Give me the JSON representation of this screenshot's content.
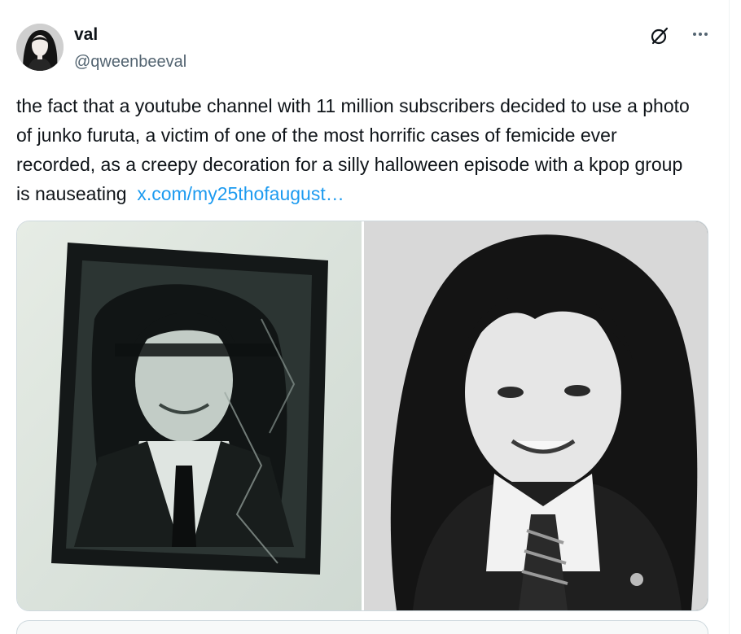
{
  "author": {
    "display_name": "val",
    "handle": "@qweenbeeval"
  },
  "tweet": {
    "text": "the fact that a youtube channel with 11 million subscribers decided to use a photo of junko furuta, a victim of one of the most horrific cases of femicide ever recorded, as a creepy decoration for a silly halloween episode with a kpop group is nauseating",
    "link_text": "x.com/my25thofaugust…"
  },
  "icons": {
    "grok": "grok-icon",
    "more": "more-icon"
  },
  "media": {
    "images": [
      {
        "name": "framed-black-and-white-photo",
        "description_icon": "photo-image"
      },
      {
        "name": "black-and-white-portrait-photo",
        "description_icon": "photo-image"
      }
    ]
  },
  "colors": {
    "link": "#1d9bf0",
    "text_primary": "#0f1419",
    "text_secondary": "#536471",
    "border": "#cfd9de"
  }
}
